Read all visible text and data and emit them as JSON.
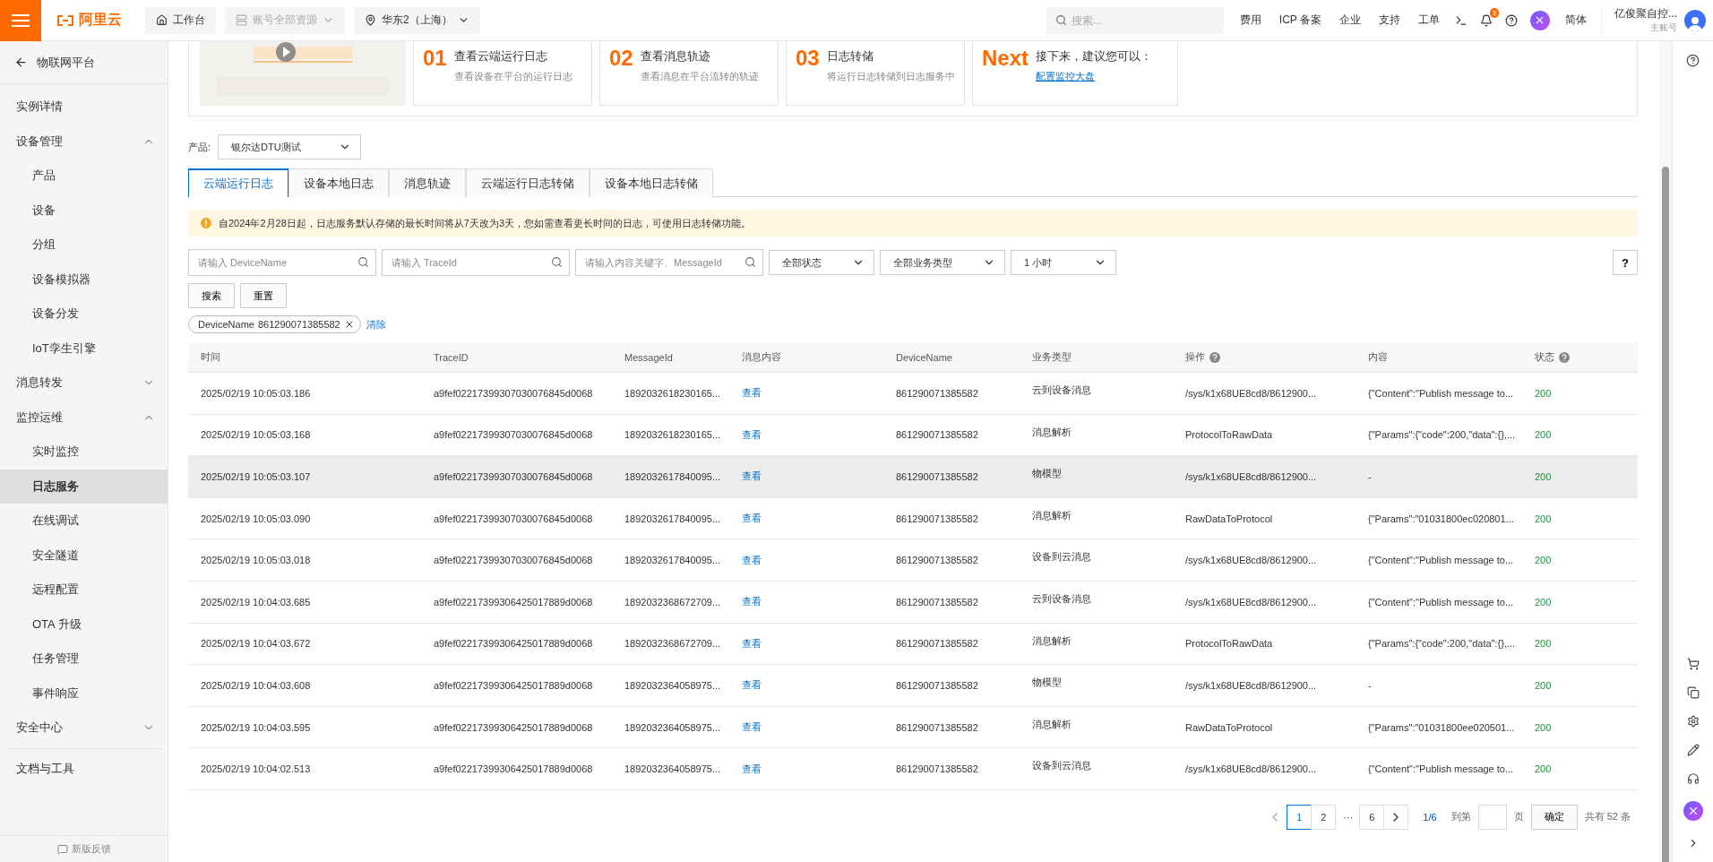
{
  "topbar": {
    "logo": "阿里云",
    "workbench": "工作台",
    "resources": "账号全部资源",
    "region": "华东2（上海）",
    "search": {
      "placeholder": "搜索..."
    },
    "links": [
      "费用",
      "ICP 备案",
      "企业",
      "支持",
      "工单"
    ],
    "notification_count": "3",
    "language": "简体",
    "user": {
      "name": "亿俊聚自控...",
      "role": "主账号"
    }
  },
  "sidebar": {
    "back": "物联网平台",
    "items": [
      {
        "label": "实例详情",
        "selected": false
      },
      {
        "label": "设备管理",
        "selected": false,
        "expanded": true,
        "children": [
          {
            "label": "产品",
            "selected": false
          },
          {
            "label": "设备",
            "selected": false
          },
          {
            "label": "分组",
            "selected": false
          },
          {
            "label": "设备模拟器",
            "selected": false
          },
          {
            "label": "设备分发",
            "selected": false
          },
          {
            "label": "IoT孪生引擎",
            "selected": false
          }
        ]
      },
      {
        "label": "消息转发",
        "selected": false,
        "expanded": false
      },
      {
        "label": "监控运维",
        "selected": false,
        "expanded": true,
        "children": [
          {
            "label": "实时监控",
            "selected": false
          },
          {
            "label": "日志服务",
            "selected": true
          },
          {
            "label": "在线调试",
            "selected": false
          },
          {
            "label": "安全隧道",
            "selected": false
          },
          {
            "label": "远程配置",
            "selected": false
          },
          {
            "label": "OTA 升级",
            "selected": false
          },
          {
            "label": "任务管理",
            "selected": false
          },
          {
            "label": "事件响应",
            "selected": false
          }
        ]
      },
      {
        "label": "安全中心",
        "selected": false,
        "expanded": false
      }
    ],
    "tools": "文档与工具",
    "feedback": "新版反馈"
  },
  "guide": {
    "steps": [
      {
        "number": "01",
        "title": "查看云端运行日志",
        "desc": "查看设备在平台的运行日志"
      },
      {
        "number": "02",
        "title": "查看消息轨迹",
        "desc": "查看消息在平台流转的轨迹"
      },
      {
        "number": "03",
        "title": "日志转储",
        "desc": "将运行日志转储到日志服务中"
      }
    ],
    "next": {
      "number": "Next",
      "title": "接下来，建议您可以：",
      "link": "配置监控大盘"
    }
  },
  "product": {
    "label": "产品:",
    "value": "银尔达DTU测试"
  },
  "tabs": [
    {
      "label": "云端运行日志",
      "selected": true
    },
    {
      "label": "设备本地日志",
      "selected": false
    },
    {
      "label": "消息轨迹",
      "selected": false
    },
    {
      "label": "云端运行日志转储",
      "selected": false
    },
    {
      "label": "设备本地日志转储",
      "selected": false
    }
  ],
  "notice": "自2024年2月28日起，日志服务默认存储的最长时间将从7天改为3天，您如需查看更长时间的日志，可使用日志转储功能。",
  "filters": {
    "inputs": [
      {
        "placeholder": "请输入 DeviceName"
      },
      {
        "placeholder": "请输入 TraceId"
      },
      {
        "placeholder": "请输入内容关键字、MessageId"
      }
    ],
    "selects": [
      "全部状态",
      "全部业务类型",
      "1 小时"
    ],
    "help": "?",
    "search": "搜索",
    "reset": "重置",
    "tag": {
      "key": "DeviceName",
      "value": "861290071385582"
    },
    "clear": "清除"
  },
  "table": {
    "columns": [
      {
        "label": "时间",
        "help": false
      },
      {
        "label": "TraceID",
        "help": false
      },
      {
        "label": "MessageId",
        "help": false
      },
      {
        "label": "消息内容",
        "help": false
      },
      {
        "label": "DeviceName",
        "help": false
      },
      {
        "label": "业务类型",
        "help": false
      },
      {
        "label": "操作",
        "help": true
      },
      {
        "label": "内容",
        "help": false
      },
      {
        "label": "状态",
        "help": true
      }
    ],
    "rows": [
      {
        "highlighted": false,
        "cells": [
          "2025/02/19 10:05:03.186",
          "a9fef02217399307030076845d0068",
          "1892032618230165...",
          "查看",
          "861290071385582",
          "云到设备消息",
          "/sys/k1x68UE8cd8/8612900...",
          "{\"Content\":\"Publish message to...",
          "200"
        ]
      },
      {
        "highlighted": false,
        "cells": [
          "2025/02/19 10:05:03.168",
          "a9fef02217399307030076845d0068",
          "1892032618230165...",
          "查看",
          "861290071385582",
          "消息解析",
          "ProtocolToRawData",
          "{\"Params\":{\"code\":200,\"data\":{},...",
          "200"
        ]
      },
      {
        "highlighted": true,
        "cells": [
          "2025/02/19 10:05:03.107",
          "a9fef02217399307030076845d0068",
          "1892032617840095...",
          "查看",
          "861290071385582",
          "物模型",
          "/sys/k1x68UE8cd8/8612900...",
          "-",
          "200"
        ]
      },
      {
        "highlighted": false,
        "cells": [
          "2025/02/19 10:05:03.090",
          "a9fef02217399307030076845d0068",
          "1892032617840095...",
          "查看",
          "861290071385582",
          "消息解析",
          "RawDataToProtocol",
          "{\"Params\":\"01031800ec020801...",
          "200"
        ]
      },
      {
        "highlighted": false,
        "cells": [
          "2025/02/19 10:05:03.018",
          "a9fef02217399307030076845d0068",
          "1892032617840095...",
          "查看",
          "861290071385582",
          "设备到云消息",
          "/sys/k1x68UE8cd8/8612900...",
          "{\"Content\":\"Publish message to...",
          "200"
        ]
      },
      {
        "highlighted": false,
        "cells": [
          "2025/02/19 10:04:03.685",
          "a9fef02217399306425017889d0068",
          "1892032368672709...",
          "查看",
          "861290071385582",
          "云到设备消息",
          "/sys/k1x68UE8cd8/8612900...",
          "{\"Content\":\"Publish message to...",
          "200"
        ]
      },
      {
        "highlighted": false,
        "cells": [
          "2025/02/19 10:04:03.672",
          "a9fef02217399306425017889d0068",
          "1892032368672709...",
          "查看",
          "861290071385582",
          "消息解析",
          "ProtocolToRawData",
          "{\"Params\":{\"code\":200,\"data\":{},...",
          "200"
        ]
      },
      {
        "highlighted": false,
        "cells": [
          "2025/02/19 10:04:03.608",
          "a9fef02217399306425017889d0068",
          "1892032364058975...",
          "查看",
          "861290071385582",
          "物模型",
          "/sys/k1x68UE8cd8/8612900...",
          "-",
          "200"
        ]
      },
      {
        "highlighted": false,
        "cells": [
          "2025/02/19 10:04:03.595",
          "a9fef02217399306425017889d0068",
          "1892032364058975...",
          "查看",
          "861290071385582",
          "消息解析",
          "RawDataToProtocol",
          "{\"Params\":\"01031800ee020501...",
          "200"
        ]
      },
      {
        "highlighted": false,
        "cells": [
          "2025/02/19 10:04:02.513",
          "a9fef02217399306425017889d0068",
          "1892032364058975...",
          "查看",
          "861290071385582",
          "设备到云消息",
          "/sys/k1x68UE8cd8/8612900...",
          "{\"Content\":\"Publish message to...",
          "200"
        ]
      }
    ]
  },
  "pagination": {
    "pages": [
      {
        "label": "1",
        "selected": true
      },
      {
        "label": "2",
        "selected": false
      },
      {
        "label": "6",
        "selected": false
      }
    ],
    "ellipsis": "···",
    "fraction": "1/6",
    "goto": "到第",
    "page_unit": "页",
    "confirm": "确定",
    "total": "共有 52 条"
  }
}
